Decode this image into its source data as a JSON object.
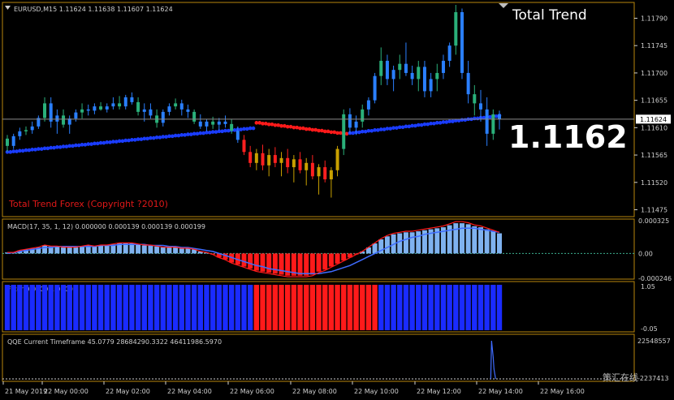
{
  "header": {
    "symbol_line": "EURUSD,M15  1.11624 1.11638 1.11607 1.11624",
    "brand": "Total Trend",
    "big_price": "1.1162",
    "copyright": "Total Trend Forex (Copyright ?2010)",
    "watermark": "策汇在线"
  },
  "colors": {
    "background": "#000000",
    "frame": "#b8860b",
    "candle_bull": "#2a7fff",
    "candle_bear": "#ff2020",
    "candle_neutral": "#2ab07a",
    "candle_warm": "#c8a000",
    "trend_up": "#1a3cff",
    "trend_down": "#ff1a1a",
    "macd_bar": "#7fb2ef",
    "macd_neg": "#ff1a1a",
    "filter_blue": "#1a2bff",
    "filter_red": "#ff1a1a",
    "qqe_line": "#3f6cff"
  },
  "price_axis": {
    "ticks": [
      "1.11790",
      "1.11745",
      "1.11700",
      "1.11655",
      "1.11610",
      "1.11565",
      "1.11520",
      "1.11475"
    ],
    "current": "1.11624"
  },
  "time_axis": {
    "ticks": [
      "21 May 2019",
      "22 May 00:00",
      "22 May 02:00",
      "22 May 04:00",
      "22 May 06:00",
      "22 May 08:00",
      "22 May 10:00",
      "22 May 12:00",
      "22 May 14:00",
      "22 May 16:00"
    ]
  },
  "macd": {
    "label": "MACD(17, 35, 1, 12) 0.000000 0.000139 0.000139 0.000199",
    "ticks": [
      "0.000325",
      "0.00",
      "-0.000246"
    ]
  },
  "filter": {
    "label": "Filter 0.0000 1.0000",
    "ticks": [
      "1.05",
      "-0.05"
    ]
  },
  "qqe": {
    "label": "QQE Current Timeframe 45.0779 28684290.3322 46411986.5970",
    "ticks": [
      "22548557",
      "-2237413"
    ]
  },
  "chart_data": {
    "type": "candlestick",
    "title": "EURUSD,M15",
    "ylim": [
      1.11465,
      1.11812
    ],
    "current_price": 1.11624,
    "candles_count": 80,
    "candles": [
      [
        1.11592,
        1.11598,
        1.1157,
        1.1158
      ],
      [
        1.1158,
        1.116,
        1.11575,
        1.11596
      ],
      [
        1.11596,
        1.1161,
        1.1159,
        1.11604
      ],
      [
        1.11604,
        1.11612,
        1.11598,
        1.11606
      ],
      [
        1.11606,
        1.1162,
        1.116,
        1.11612
      ],
      [
        1.11612,
        1.1163,
        1.11608,
        1.11626
      ],
      [
        1.11626,
        1.1166,
        1.1162,
        1.1165
      ],
      [
        1.1165,
        1.1166,
        1.1161,
        1.1162
      ],
      [
        1.1162,
        1.1164,
        1.116,
        1.1163
      ],
      [
        1.1163,
        1.1164,
        1.1161,
        1.11615
      ],
      [
        1.11615,
        1.1163,
        1.116,
        1.11625
      ],
      [
        1.11625,
        1.1164,
        1.1162,
        1.11635
      ],
      [
        1.11635,
        1.1165,
        1.11625,
        1.1164
      ],
      [
        1.1164,
        1.11648,
        1.1163,
        1.11638
      ],
      [
        1.11638,
        1.1165,
        1.11632,
        1.11645
      ],
      [
        1.11645,
        1.11652,
        1.11638,
        1.1164
      ],
      [
        1.1164,
        1.1165,
        1.11635,
        1.11645
      ],
      [
        1.11645,
        1.1166,
        1.1164,
        1.1165
      ],
      [
        1.1165,
        1.11662,
        1.1164,
        1.11645
      ],
      [
        1.11645,
        1.11664,
        1.1164,
        1.1166
      ],
      [
        1.1166,
        1.11668,
        1.11648,
        1.11652
      ],
      [
        1.11652,
        1.1166,
        1.1163,
        1.11636
      ],
      [
        1.11636,
        1.1165,
        1.1162,
        1.1164
      ],
      [
        1.1164,
        1.1165,
        1.11625,
        1.1163
      ],
      [
        1.1163,
        1.1164,
        1.1161,
        1.11618
      ],
      [
        1.11618,
        1.1164,
        1.11612,
        1.11636
      ],
      [
        1.11636,
        1.1165,
        1.1163,
        1.11645
      ],
      [
        1.11645,
        1.11658,
        1.1164,
        1.1165
      ],
      [
        1.1165,
        1.11656,
        1.1163,
        1.1164
      ],
      [
        1.1164,
        1.11648,
        1.11626,
        1.11636
      ],
      [
        1.11636,
        1.1164,
        1.11616,
        1.1162
      ],
      [
        1.1162,
        1.11632,
        1.11608,
        1.11612
      ],
      [
        1.11612,
        1.11624,
        1.11604,
        1.1162
      ],
      [
        1.1162,
        1.11628,
        1.11608,
        1.11615
      ],
      [
        1.11615,
        1.11626,
        1.11606,
        1.1162
      ],
      [
        1.1162,
        1.1163,
        1.1161,
        1.11616
      ],
      [
        1.11616,
        1.11624,
        1.116,
        1.11605
      ],
      [
        1.11605,
        1.11612,
        1.11585,
        1.1159
      ],
      [
        1.1159,
        1.11598,
        1.11565,
        1.1157
      ],
      [
        1.1157,
        1.1158,
        1.11545,
        1.11552
      ],
      [
        1.11552,
        1.11575,
        1.1154,
        1.11568
      ],
      [
        1.11568,
        1.11582,
        1.1154,
        1.11548
      ],
      [
        1.11548,
        1.11575,
        1.1153,
        1.11565
      ],
      [
        1.11565,
        1.11578,
        1.11545,
        1.11552
      ],
      [
        1.11552,
        1.1157,
        1.1153,
        1.1156
      ],
      [
        1.1156,
        1.11575,
        1.11535,
        1.11545
      ],
      [
        1.11545,
        1.11565,
        1.1152,
        1.11558
      ],
      [
        1.11558,
        1.1157,
        1.11535,
        1.1154
      ],
      [
        1.1154,
        1.1156,
        1.11515,
        1.11552
      ],
      [
        1.11552,
        1.11565,
        1.11525,
        1.1153
      ],
      [
        1.1153,
        1.1155,
        1.115,
        1.11545
      ],
      [
        1.11545,
        1.11556,
        1.1152,
        1.11525
      ],
      [
        1.11525,
        1.11545,
        1.11495,
        1.1154
      ],
      [
        1.1154,
        1.1158,
        1.1153,
        1.11575
      ],
      [
        1.11575,
        1.1164,
        1.11565,
        1.11632
      ],
      [
        1.11632,
        1.11642,
        1.116,
        1.1161
      ],
      [
        1.1161,
        1.1163,
        1.11598,
        1.1162
      ],
      [
        1.1162,
        1.11648,
        1.1161,
        1.1164
      ],
      [
        1.1164,
        1.1166,
        1.1163,
        1.11655
      ],
      [
        1.11655,
        1.117,
        1.1165,
        1.11695
      ],
      [
        1.11695,
        1.11742,
        1.1168,
        1.1172
      ],
      [
        1.1172,
        1.1173,
        1.1168,
        1.1169
      ],
      [
        1.1169,
        1.11712,
        1.1167,
        1.11705
      ],
      [
        1.11705,
        1.1173,
        1.1169,
        1.11715
      ],
      [
        1.11715,
        1.1175,
        1.11695,
        1.117
      ],
      [
        1.117,
        1.11712,
        1.1168,
        1.1169
      ],
      [
        1.1169,
        1.1172,
        1.1167,
        1.1171
      ],
      [
        1.1171,
        1.1172,
        1.1166,
        1.1167
      ],
      [
        1.1167,
        1.117,
        1.1166,
        1.1169
      ],
      [
        1.1169,
        1.11715,
        1.1167,
        1.117
      ],
      [
        1.117,
        1.1173,
        1.1169,
        1.1172
      ],
      [
        1.1172,
        1.1175,
        1.1171,
        1.11745
      ],
      [
        1.11745,
        1.11812,
        1.1173,
        1.118
      ],
      [
        1.118,
        1.11806,
        1.1169,
        1.117
      ],
      [
        1.117,
        1.1172,
        1.1165,
        1.11665
      ],
      [
        1.11665,
        1.1168,
        1.1163,
        1.1165
      ],
      [
        1.1165,
        1.11672,
        1.1162,
        1.1164
      ],
      [
        1.1164,
        1.1166,
        1.1158,
        1.116
      ],
      [
        1.116,
        1.1164,
        1.1159,
        1.11632
      ],
      [
        1.11632,
        1.11638,
        1.11607,
        1.11624
      ]
    ],
    "trend_line": {
      "start_value": 1.1157,
      "mid_value": 1.1161,
      "end_value": 1.1163,
      "red_segment_start": 1.11618,
      "red_segment_end": 1.116
    },
    "macd_values": [
      1e-05,
      1e-05,
      3e-05,
      4e-05,
      5e-05,
      6e-05,
      8e-05,
      7e-05,
      7e-05,
      6e-05,
      6e-05,
      6e-05,
      7e-05,
      8e-05,
      7e-05,
      8e-05,
      8e-05,
      9e-05,
      0.0001,
      0.0001,
      0.0001,
      9e-05,
      8e-05,
      8e-05,
      7e-05,
      6e-05,
      6e-05,
      6e-05,
      5e-05,
      5e-05,
      4e-05,
      2e-05,
      1e-05,
      -1e-05,
      -4e-05,
      -6e-05,
      -9e-05,
      -0.00011,
      -0.00013,
      -0.00015,
      -0.00017,
      -0.00018,
      -0.00019,
      -0.0002,
      -0.00021,
      -0.00022,
      -0.00022,
      -0.00022,
      -0.00022,
      -0.00021,
      -0.00018,
      -0.00016,
      -0.00013,
      -0.0001,
      -7e-05,
      -4e-05,
      -1e-05,
      2e-05,
      6e-05,
      0.0001,
      0.00014,
      0.00017,
      0.00019,
      0.0002,
      0.00021,
      0.00021,
      0.00022,
      0.00023,
      0.00024,
      0.00025,
      0.00026,
      0.00028,
      0.0003,
      0.0003,
      0.00029,
      0.00027,
      0.00026,
      0.00024,
      0.00022,
      0.0002
    ],
    "macd_signal": [
      0.0,
      1e-05,
      2e-05,
      3e-05,
      4e-05,
      5e-05,
      6e-05,
      6e-05,
      7e-05,
      7e-05,
      7e-05,
      7e-05,
      7e-05,
      7e-05,
      7e-05,
      8e-05,
      8e-05,
      8e-05,
      9e-05,
      9e-05,
      9e-05,
      9e-05,
      9e-05,
      8e-05,
      8e-05,
      8e-05,
      7e-05,
      7e-05,
      6e-05,
      6e-05,
      5e-05,
      4e-05,
      3e-05,
      2e-05,
      0.0,
      -2e-05,
      -4e-05,
      -6e-05,
      -8e-05,
      -0.0001,
      -0.00012,
      -0.00013,
      -0.00015,
      -0.00016,
      -0.00017,
      -0.00018,
      -0.00019,
      -0.0002,
      -0.0002,
      -0.0002,
      -0.0002,
      -0.00019,
      -0.00018,
      -0.00016,
      -0.00014,
      -0.00012,
      -9e-05,
      -6e-05,
      -3e-05,
      0.0,
      3e-05,
      6e-05,
      9e-05,
      0.00012,
      0.00014,
      0.00016,
      0.00017,
      0.00019,
      0.0002,
      0.00021,
      0.00022,
      0.00023,
      0.00024,
      0.00025,
      0.00025,
      0.00025,
      0.00024,
      0.00023,
      0.00022,
      0.00021
    ],
    "filter_values": [
      1,
      1,
      1,
      1,
      1,
      1,
      1,
      1,
      1,
      1,
      1,
      1,
      1,
      1,
      1,
      1,
      1,
      1,
      1,
      1,
      1,
      1,
      1,
      1,
      1,
      1,
      1,
      1,
      1,
      1,
      1,
      1,
      1,
      1,
      1,
      1,
      1,
      1,
      1,
      1,
      -1,
      -1,
      -1,
      -1,
      -1,
      -1,
      -1,
      -1,
      -1,
      -1,
      -1,
      -1,
      -1,
      -1,
      -1,
      -1,
      -1,
      -1,
      -1,
      -1,
      1,
      1,
      1,
      1,
      1,
      1,
      1,
      1,
      1,
      1,
      1,
      1,
      1,
      1,
      1,
      1,
      1,
      1,
      1,
      1
    ],
    "qqe_spike_index": 78
  }
}
